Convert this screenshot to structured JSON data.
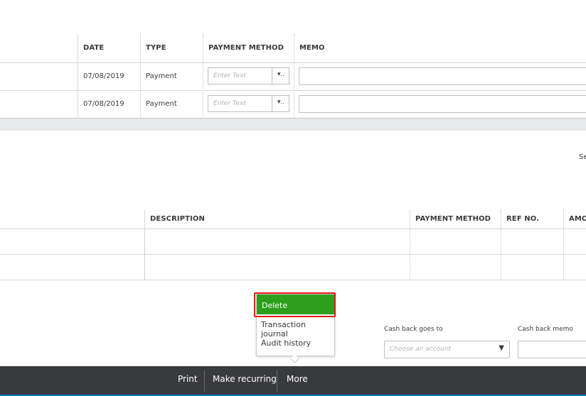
{
  "top_table": {
    "headers": [
      "DATE",
      "TYPE",
      "PAYMENT METHOD",
      "MEMO"
    ],
    "rows": [
      {
        "date": "07/08/2019",
        "type": "Payment",
        "payment_method_placeholder": "Enter Text"
      },
      {
        "date": "07/08/2019",
        "type": "Payment",
        "payment_method_placeholder": "Enter Text"
      }
    ]
  },
  "right_edge_text": "Se",
  "bottom_table": {
    "headers": [
      "DESCRIPTION",
      "PAYMENT METHOD",
      "REF NO.",
      "AMO"
    ]
  },
  "more_menu": {
    "items": [
      "Delete",
      "Transaction journal",
      "Audit history"
    ],
    "highlight_color": "#2ca01c",
    "focus_border_color": "#e8141b"
  },
  "cash_back": {
    "goes_to_label": "Cash back goes to",
    "goes_to_placeholder": "Choose an account",
    "memo_label": "Cash back memo"
  },
  "footer": {
    "print": "Print",
    "make_recurring": "Make recurring",
    "more": "More",
    "background": "#393a3d"
  }
}
